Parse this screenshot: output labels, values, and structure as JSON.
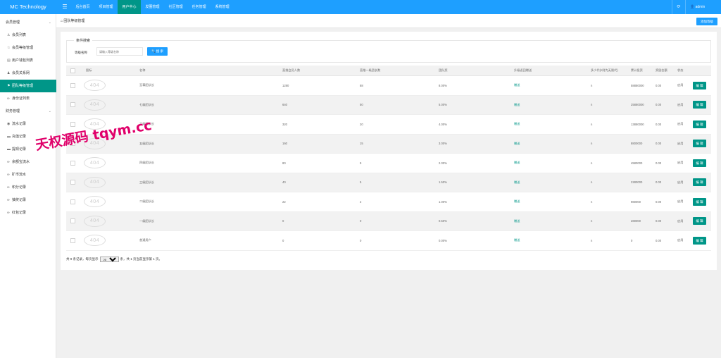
{
  "app": {
    "brand": "MC Technology",
    "accent_color": "#1e9fff",
    "active_color": "#009688"
  },
  "topnav": {
    "menu_icon": "menu-icon",
    "items": [
      "后台首页",
      "项目管理",
      "用户中心",
      "发圈管理",
      "社区管理",
      "任务管理",
      "系统管理"
    ],
    "active_index": 2,
    "refresh_icon": "refresh-icon",
    "user_icon": "user-icon",
    "user": "admin"
  },
  "sidebar": {
    "groups": [
      {
        "label": "会员管理",
        "expanded": true,
        "items": [
          {
            "label": "会员列表",
            "icon": "user-icon"
          },
          {
            "label": "会员等级管理",
            "icon": "star-icon"
          },
          {
            "label": "用户钱包列表",
            "icon": "wallet-icon"
          },
          {
            "label": "会员关系网",
            "icon": "users-icon"
          },
          {
            "label": "团队等级管理",
            "icon": "team-icon",
            "active": true
          },
          {
            "label": "身份证列表",
            "icon": "link-icon"
          }
        ]
      },
      {
        "label": "财务管理",
        "expanded": true,
        "items": [
          {
            "label": "流水记录",
            "icon": "list-icon"
          },
          {
            "label": "充值记录",
            "icon": "card-icon"
          },
          {
            "label": "提现记录",
            "icon": "card-icon"
          },
          {
            "label": "余额宝流水",
            "icon": "link-icon"
          },
          {
            "label": "矿币流水",
            "icon": "link-icon"
          },
          {
            "label": "积分记录",
            "icon": "link-icon"
          },
          {
            "label": "抽奖记录",
            "icon": "link-icon"
          },
          {
            "label": "红包记录",
            "icon": "link-icon"
          }
        ]
      }
    ]
  },
  "breadcrumb": "团队等级管理",
  "add_button": "添加等级",
  "search": {
    "legend": "条件搜索",
    "label": "等级名称",
    "placeholder": "请输入等级名称",
    "button": "搜 索",
    "button_icon": "search-icon"
  },
  "table": {
    "columns": [
      "",
      "图标",
      "名称",
      "直推会员人数",
      "直推一级团长数",
      "团队奖",
      "升级返回赠送",
      "多少代(n则为无限代)",
      "累计投资",
      "奖励金额",
      "状态",
      ""
    ],
    "image_placeholder": "404",
    "rows": [
      {
        "name": "至尊团队长",
        "direct_members": "1280",
        "direct_leaders": "88",
        "bonus": "8.00%",
        "gift": "赠送",
        "generations": "n",
        "investment": "58880000",
        "reward": "0.00",
        "status": "启用",
        "action": "编 辑"
      },
      {
        "name": "七级团队长",
        "direct_members": "640",
        "direct_leaders": "50",
        "bonus": "5.00%",
        "gift": "赠送",
        "generations": "n",
        "investment": "25880000",
        "reward": "0.00",
        "status": "启用",
        "action": "编 辑"
      },
      {
        "name": "六级团队长",
        "direct_members": "320",
        "direct_leaders": "20",
        "bonus": "4.00%",
        "gift": "赠送",
        "generations": "n",
        "investment": "13880000",
        "reward": "0.00",
        "status": "启用",
        "action": "编 辑"
      },
      {
        "name": "五级团队长",
        "direct_members": "160",
        "direct_leaders": "15",
        "bonus": "3.00%",
        "gift": "赠送",
        "generations": "n",
        "investment": "8800000",
        "reward": "0.00",
        "status": "启用",
        "action": "编 辑"
      },
      {
        "name": "四级团队长",
        "direct_members": "80",
        "direct_leaders": "9",
        "bonus": "2.00%",
        "gift": "赠送",
        "generations": "n",
        "investment": "4580000",
        "reward": "0.00",
        "status": "启用",
        "action": "编 辑"
      },
      {
        "name": "三级团队长",
        "direct_members": "40",
        "direct_leaders": "5",
        "bonus": "1.50%",
        "gift": "赠送",
        "generations": "n",
        "investment": "2280000",
        "reward": "0.00",
        "status": "启用",
        "action": "编 辑"
      },
      {
        "name": "二级团队长",
        "direct_members": "22",
        "direct_leaders": "2",
        "bonus": "1.00%",
        "gift": "赠送",
        "generations": "n",
        "investment": "980000",
        "reward": "0.00",
        "status": "启用",
        "action": "编 辑"
      },
      {
        "name": "一级团队长",
        "direct_members": "0",
        "direct_leaders": "0",
        "bonus": "0.50%",
        "gift": "赠送",
        "generations": "n",
        "investment": "280000",
        "reward": "0.00",
        "status": "启用",
        "action": "编 辑"
      },
      {
        "name": "普通用户",
        "direct_members": "0",
        "direct_leaders": "0",
        "bonus": "0.00%",
        "gift": "赠送",
        "generations": "n",
        "investment": "0",
        "reward": "0.00",
        "status": "启用",
        "action": "编 辑"
      }
    ]
  },
  "pager": {
    "before": "共 9 条记录，每页显示",
    "page_size": "20",
    "after": "条，共 1 页当前显示第 1 页。"
  },
  "watermark": "天权源码 tqym.cc"
}
